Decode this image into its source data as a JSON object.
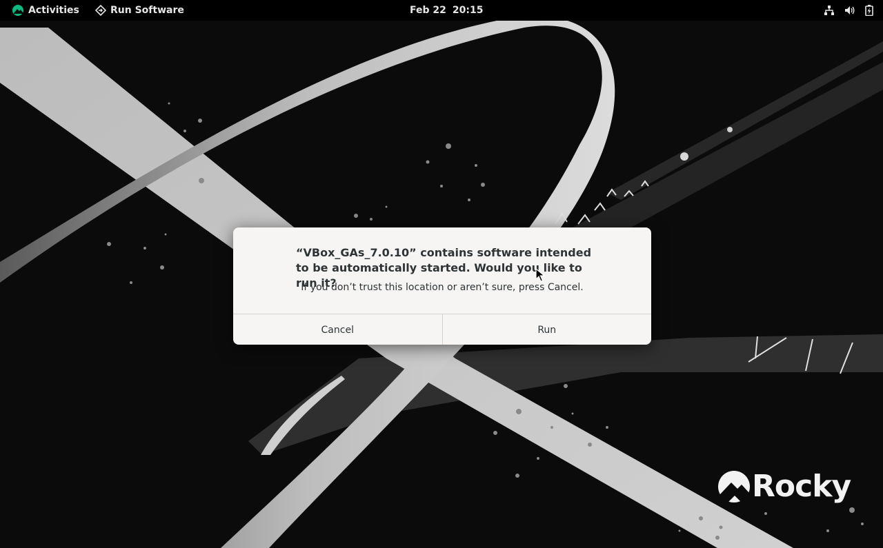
{
  "topbar": {
    "activities_label": "Activities",
    "app_menu_label": "Run Software",
    "clock_date": "Feb 22",
    "clock_time": "20:15",
    "tray_icons": [
      "network-icon",
      "volume-icon",
      "battery-icon"
    ]
  },
  "dialog": {
    "title": "“VBox_GAs_7.0.10” contains software intended to be automatically started. Would you like to run it?",
    "body": "If you don’t trust this location or aren’t sure, press Cancel.",
    "cancel_label": "Cancel",
    "run_label": "Run"
  },
  "desktop": {
    "logo_text": "Rocky"
  },
  "colors": {
    "topbar_bg": "#000000",
    "dialog_bg": "#f6f5f4",
    "rocky_green": "#10b981",
    "wallpaper_stroke": "#c8c8c8"
  }
}
